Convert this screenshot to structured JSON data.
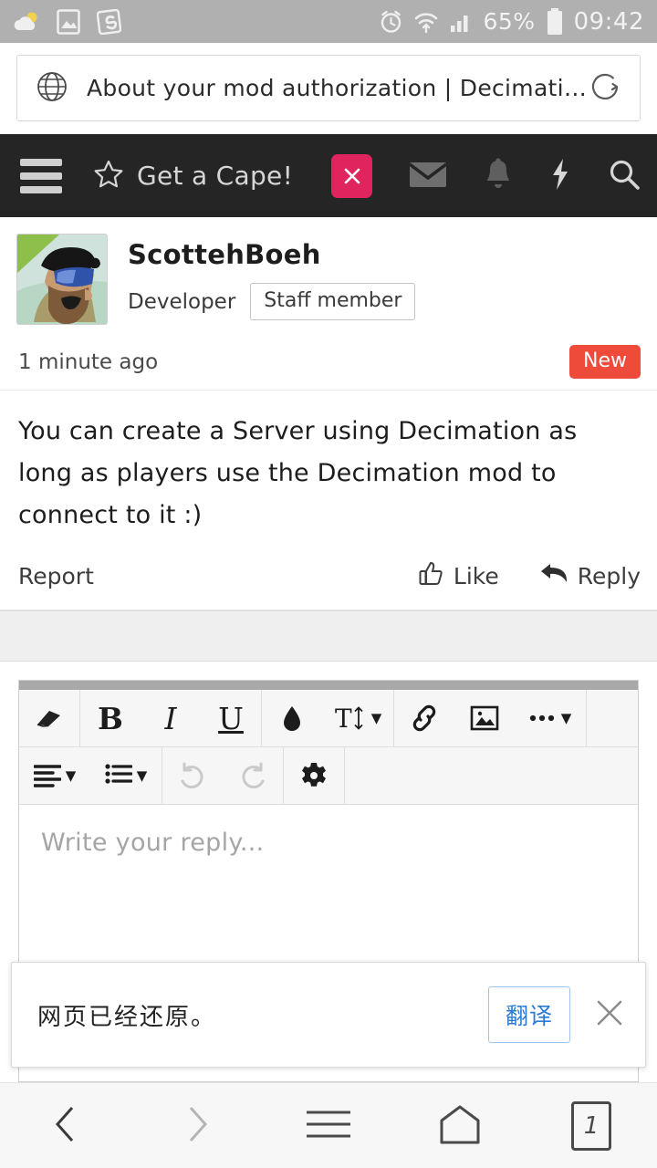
{
  "statusbar": {
    "left_icons": [
      "weather-cloud-sun-icon",
      "gallery-photo-icon",
      "sogou-app-icon"
    ],
    "alarm_icon": "alarm-clock-icon",
    "wifi_icon": "wifi-icon",
    "signal_icon": "cellular-signal-icon",
    "battery_percent": "65%",
    "battery_icon": "battery-icon",
    "time": "09:42"
  },
  "urlbar": {
    "globe_icon": "globe-icon",
    "title": "About your mod authorization | Decimation",
    "reload_icon": "reload-icon"
  },
  "sitenav": {
    "menu_icon": "hamburger-menu-icon",
    "star_icon": "star-icon",
    "cape_label": "Get a Cape!",
    "close_label": "X",
    "close_bg": "#e0245e",
    "mail_icon": "envelope-icon",
    "bell_icon": "bell-icon",
    "bolt_icon": "lightning-bolt-icon",
    "search_icon": "search-icon"
  },
  "post": {
    "avatar_alt": "scottehboeh-avatar",
    "author": "ScottehBoeh",
    "role": "Developer",
    "staff_badge": "Staff member",
    "timestamp": "1 minute ago",
    "new_badge": "New",
    "new_badge_color": "#ef4b3a",
    "body": "You can create a Server using Decimation as long as players use the Decimation mod to connect to it :)",
    "report_label": "Report",
    "like_label": "Like",
    "reply_label": "Reply"
  },
  "editor": {
    "toolbar_row1": [
      {
        "name": "remove-format-icon",
        "label": ""
      },
      {
        "name": "bold-icon",
        "label": "B"
      },
      {
        "name": "italic-icon",
        "label": "I"
      },
      {
        "name": "underline-icon",
        "label": "U"
      },
      {
        "name": "text-color-icon",
        "label": ""
      },
      {
        "name": "font-size-icon",
        "label": "T"
      },
      {
        "name": "link-icon",
        "label": ""
      },
      {
        "name": "image-icon",
        "label": ""
      },
      {
        "name": "more-options-icon",
        "label": ""
      }
    ],
    "toolbar_row2": [
      {
        "name": "align-icon",
        "label": ""
      },
      {
        "name": "list-icon",
        "label": ""
      },
      {
        "name": "undo-icon",
        "label": ""
      },
      {
        "name": "redo-icon",
        "label": ""
      },
      {
        "name": "settings-gear-icon",
        "label": ""
      }
    ],
    "placeholder": "Write your reply..."
  },
  "translate_bar": {
    "message": "网页已经还原。",
    "translate_label": "翻译",
    "close_icon": "close-icon",
    "accent": "#2a7bd4"
  },
  "bottomnav": {
    "back_icon": "back-chevron-icon",
    "forward_icon": "forward-chevron-icon",
    "menu_icon": "hamburger-menu-icon",
    "home_icon": "home-icon",
    "tab_count": "1"
  }
}
